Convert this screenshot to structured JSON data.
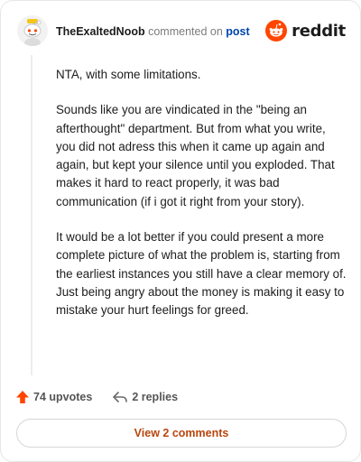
{
  "header": {
    "username": "TheExaltedNoob",
    "verb": "commented on",
    "target": "post",
    "brand": "reddit",
    "brand_color": "#ff4500"
  },
  "comment": {
    "paragraphs": [
      "NTA, with some limitations.",
      "Sounds like you are vindicated in the \"being an afterthought\" department. But from what you write, you did not adress this when it came up again and again, but kept your silence until you exploded. That makes it hard to react properly, it was bad communication (if i got it right from your story).",
      "It would be a lot better if you could present a more complete picture of what the problem is, starting from the earliest instances you still have a clear memory of. Just being angry about the money is making it easy to mistake your hurt feelings for greed."
    ]
  },
  "actions": {
    "upvotes_label": "74 upvotes",
    "replies_label": "2 replies",
    "upvote_icon": "upvote-arrow-icon",
    "reply_icon": "reply-arrow-icon",
    "upvote_color": "#ff4500"
  },
  "view_button": {
    "label": "View 2 comments",
    "color": "#b8460e"
  }
}
